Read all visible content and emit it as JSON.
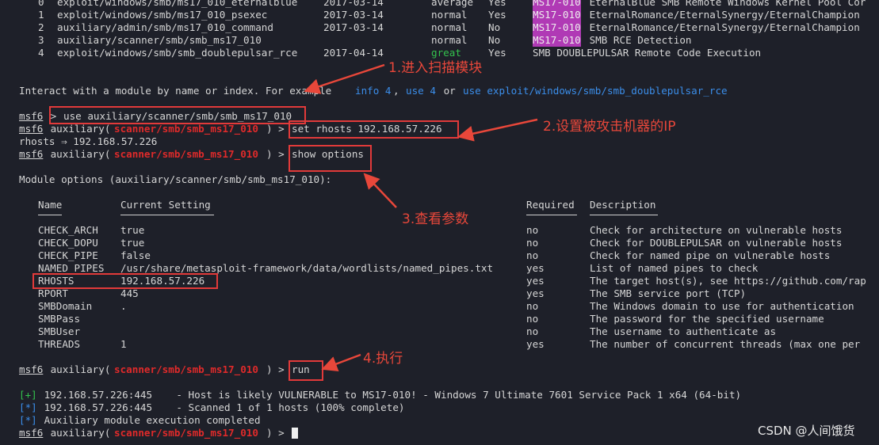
{
  "search_results": [
    {
      "idx": "0",
      "name": "exploit/windows/smb/ms17_010_eternalblue",
      "date": "2017-03-14",
      "rank": "average",
      "check": "Yes",
      "tag": "MS17-010",
      "desc": " EternalBlue SMB Remote Windows Kernel Pool Cor"
    },
    {
      "idx": "1",
      "name": "exploit/windows/smb/ms17_010_psexec",
      "date": "2017-03-14",
      "rank": "normal",
      "check": "Yes",
      "tag": "MS17-010",
      "desc": " EternalRomance/EternalSynergy/EternalChampion"
    },
    {
      "idx": "2",
      "name": "auxiliary/admin/smb/ms17_010_command",
      "date": "2017-03-14",
      "rank": "normal",
      "check": "No",
      "tag": "MS17-010",
      "desc": " EternalRomance/EternalSynergy/EternalChampion"
    },
    {
      "idx": "3",
      "name": "auxiliary/scanner/smb/smb_ms17_010",
      "date": "",
      "rank": "normal",
      "check": "No",
      "tag": "MS17-010",
      "desc": " SMB RCE Detection"
    },
    {
      "idx": "4",
      "name": "exploit/windows/smb/smb_doublepulsar_rce",
      "date": "2017-04-14",
      "rank": "great",
      "check": "Yes",
      "tag": "",
      "desc": "SMB DOUBLEPULSAR Remote Code Execution"
    }
  ],
  "interact": {
    "prefix": "Interact with a module by name or index. For example ",
    "info": "info 4",
    "comma": ", ",
    "use": "use 4",
    "or": " or ",
    "use_full": "use exploit/windows/smb/smb_doublepulsar_rce"
  },
  "prompt": {
    "msf": "msf6",
    "aux_open": " auxiliary(",
    "module": "scanner/smb/smb_ms17_010",
    "aux_close": ") > ",
    "plain": " > "
  },
  "commands": {
    "use": "use auxiliary/scanner/smb/smb_ms17_010",
    "set": "set rhosts 192.168.57.226",
    "set_result": "rhosts ⇒ 192.168.57.226",
    "show": "show options",
    "run": "run"
  },
  "module_options_title": "Module options (auxiliary/scanner/smb/smb_ms17_010):",
  "options_headers": {
    "name": "Name",
    "setting": "Current Setting",
    "required": "Required",
    "description": "Description"
  },
  "options": [
    {
      "name": "CHECK_ARCH",
      "setting": "true",
      "required": "no",
      "description": "Check for architecture on vulnerable hosts"
    },
    {
      "name": "CHECK_DOPU",
      "setting": "true",
      "required": "no",
      "description": "Check for DOUBLEPULSAR on vulnerable hosts"
    },
    {
      "name": "CHECK_PIPE",
      "setting": "false",
      "required": "no",
      "description": "Check for named pipe on vulnerable hosts"
    },
    {
      "name": "NAMED_PIPES",
      "setting": "/usr/share/metasploit-framework/data/wordlists/named_pipes.txt",
      "required": "yes",
      "description": "List of named pipes to check"
    },
    {
      "name": "RHOSTS",
      "setting": "192.168.57.226",
      "required": "yes",
      "description": "The target host(s), see https://github.com/rap"
    },
    {
      "name": "RPORT",
      "setting": "445",
      "required": "yes",
      "description": "The SMB service port (TCP)"
    },
    {
      "name": "SMBDomain",
      "setting": ".",
      "required": "no",
      "description": "The Windows domain to use for authentication"
    },
    {
      "name": "SMBPass",
      "setting": "",
      "required": "no",
      "description": "The password for the specified username"
    },
    {
      "name": "SMBUser",
      "setting": "",
      "required": "no",
      "description": "The username to authenticate as"
    },
    {
      "name": "THREADS",
      "setting": "1",
      "required": "yes",
      "description": "The number of concurrent threads (max one per"
    }
  ],
  "results": [
    {
      "tag": "[+]",
      "tag_color": "green",
      "text": " 192.168.57.226:445    - Host is likely VULNERABLE to MS17-010! - Windows 7 Ultimate 7601 Service Pack 1 x64 (64-bit)"
    },
    {
      "tag": "[*]",
      "tag_color": "blue",
      "text": " 192.168.57.226:445    - Scanned 1 of 1 hosts (100% complete)"
    },
    {
      "tag": "[*]",
      "tag_color": "blue",
      "text": " Auxiliary module execution completed"
    }
  ],
  "annotations": {
    "a1": "1.进入扫描模块",
    "a2": "2.设置被攻击机器的IP",
    "a3": "3.查看参数",
    "a4": "4.执行"
  },
  "watermark": "CSDN @人间饿货",
  "colors": {
    "background": "#1e2029",
    "module_red": "#e02a2a",
    "tag_purple": "#b03ab5",
    "annotation_red": "#e8473a",
    "success_green": "#33c24d",
    "info_blue": "#3b8eea"
  }
}
